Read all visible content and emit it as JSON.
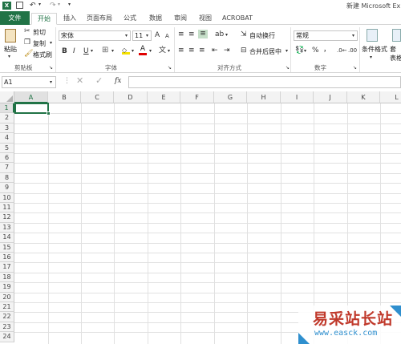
{
  "titlebar": {
    "title": "新建 Microsoft Ex"
  },
  "tabs": [
    {
      "label": "文件"
    },
    {
      "label": "开始"
    },
    {
      "label": "插入"
    },
    {
      "label": "页面布局"
    },
    {
      "label": "公式"
    },
    {
      "label": "数据"
    },
    {
      "label": "审阅"
    },
    {
      "label": "视图"
    },
    {
      "label": "ACROBAT"
    }
  ],
  "clipboard": {
    "paste": "粘贴",
    "cut": "剪切",
    "copy": "复制",
    "format_painter": "格式刷",
    "group": "剪贴板"
  },
  "font": {
    "name": "宋体",
    "size": "11",
    "grow": "A",
    "shrink": "A",
    "bold": "B",
    "italic": "I",
    "underline": "U",
    "group": "字体"
  },
  "alignment": {
    "wrap": "自动换行",
    "merge": "合并后居中",
    "group": "对齐方式"
  },
  "number": {
    "format": "常规",
    "percent": "%",
    "comma": "，",
    "group": "数字"
  },
  "styles": {
    "conditional": "条件格式",
    "table": "套\n表格"
  },
  "formula_bar": {
    "name_box": "A1",
    "fx": "fx",
    "value": ""
  },
  "columns": [
    "A",
    "B",
    "C",
    "D",
    "E",
    "F",
    "G",
    "H",
    "I",
    "J",
    "K",
    "L"
  ],
  "rows": [
    "1",
    "2",
    "3",
    "4",
    "5",
    "6",
    "7",
    "8",
    "9",
    "10",
    "11",
    "12",
    "13",
    "14",
    "15",
    "16",
    "17",
    "18",
    "19",
    "20",
    "21",
    "22",
    "23",
    "24"
  ],
  "watermark": {
    "text": "易采站长站",
    "url": "www.easck.com"
  },
  "colors": {
    "accent": "#217346",
    "watermark_red": "#c0392b",
    "watermark_blue": "#2f8fce"
  }
}
